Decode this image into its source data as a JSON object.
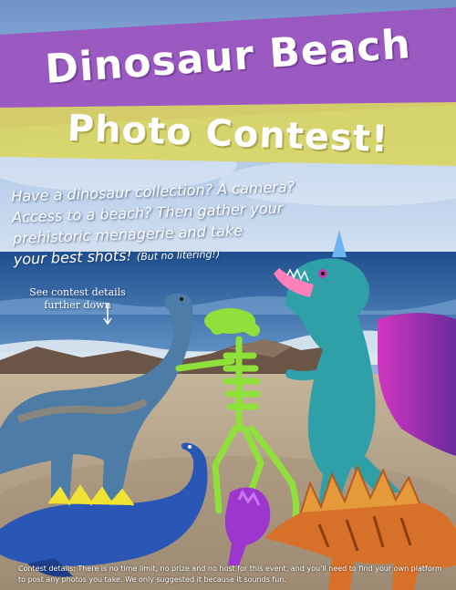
{
  "poster": {
    "title": "Dinosaur Beach",
    "subtitle": "Photo Contest!",
    "intro_line1": "Have a dinosaur collection? A camera?",
    "intro_line2": "Access to a beach? Then gather your",
    "intro_line3": "prehistoric menagerie and take",
    "intro_line4": "your best shots!",
    "intro_aside": "(But no litering!)",
    "details_pointer_line1": "See contest details",
    "details_pointer_line2": "further down",
    "contest_details": "Contest details: There is no time limit, no prize and no host for this event, and you'll need to find your own platform to post any photos you take. We only suggested it because it sounds fun."
  },
  "colors": {
    "purple_banner": "#9b55c0",
    "yellow_banner": "#d9d663",
    "sky": "#a8c4e8",
    "sea": "#2d5fa3",
    "sand": "#b8a58a"
  },
  "icons": {
    "pointer": "down-arrow-icon"
  }
}
